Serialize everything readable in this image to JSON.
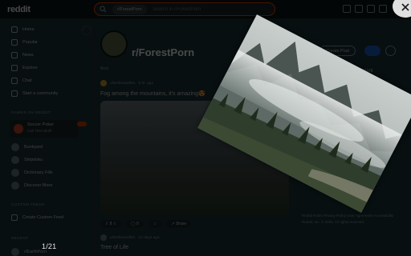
{
  "header": {
    "logo": "reddit",
    "search_chip": "r/ForestPorn",
    "search_placeholder": "Search in r/ForestPorn"
  },
  "sidebar": {
    "items": [
      {
        "label": "Home",
        "icon": "home-icon"
      },
      {
        "label": "Popular",
        "icon": "popular-icon"
      },
      {
        "label": "News",
        "icon": "news-icon"
      },
      {
        "label": "Explore",
        "icon": "explore-icon"
      },
      {
        "label": "Chat",
        "icon": "chat-icon"
      }
    ],
    "start_community": "Start a community",
    "games_label": "GAMES ON REDDIT",
    "promo": {
      "title": "Soccer Poker",
      "subtitle": "Call Their Bluff!"
    },
    "games": [
      "Bunkyard",
      "Stripdoku",
      "Dictionary Fills",
      "Discover More"
    ],
    "custom_feeds_label": "CUSTOM FEEDS",
    "create_custom_feed": "Create Custom Feed",
    "recent_label": "RECENT",
    "recent_item": "r/EarthPorn"
  },
  "subreddit": {
    "name": "r/ForestPorn",
    "create_post": "Create Post",
    "sort": "Best"
  },
  "posts": [
    {
      "user": "u/Bellisswell01",
      "time": "5 hr. ago",
      "title": "Fog among the mountains, it's amazing😍",
      "votes": "8",
      "comments": "0",
      "share": "Share"
    },
    {
      "user": "u/Bellisswell01",
      "time": "12 days ago",
      "title": "Tree of Life"
    }
  ],
  "right_panel": {
    "snippet": "...rial woody plant"
  },
  "footer": "Reddit Rules  Privacy Policy  User Agreement  Accessibility  Reddit, Inc. © 2025. All rights reserved.",
  "lightbox": {
    "counter": "1/21"
  }
}
